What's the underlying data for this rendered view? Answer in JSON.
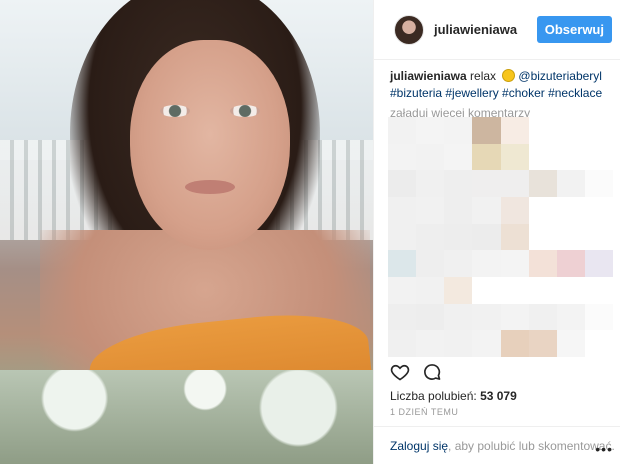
{
  "post": {
    "username": "juliawieniawa",
    "follow_label": "Obserwuj",
    "caption_user": "juliawieniawa",
    "caption_text": "relax",
    "caption_mention": "@bizuteriaberyl",
    "hashtags": "#bizuteria #jewellery #choker #necklace",
    "load_more": "załaduj więcej komentarzy",
    "likes_label": "Liczba polubień:",
    "likes_count": "53 079",
    "time_ago": "1 DZIEŃ TEMU",
    "login_link": "Zaloguj się",
    "login_rest": ", aby polubić lub skomentować.",
    "more_dots": "•••"
  },
  "colors": {
    "accent": "#3897f0",
    "link": "#003569",
    "muted": "#999999"
  },
  "icons": [
    "heart-icon",
    "comment-icon",
    "sun-emoji-icon",
    "more-options-icon"
  ],
  "blurred_pixels": [
    "#f2f2f2",
    "#f4f4f4",
    "#f3f3f3",
    "#cdb6a0",
    "#f7ece4",
    "#ffffff",
    "#ffffff",
    "#ffffff",
    "#f3f3f3",
    "#f2f2f2",
    "#f4f4f4",
    "#e6d8b6",
    "#efe8d2",
    "#ffffff",
    "#ffffff",
    "#ffffff",
    "#ececec",
    "#f0f0f0",
    "#eeeeee",
    "#efeeee",
    "#efeeee",
    "#e8e2da",
    "#f2f2f2",
    "#fbfbfb",
    "#f0f0f0",
    "#f1f1f1",
    "#eeeeee",
    "#f1f1f1",
    "#f0e6df",
    "#ffffff",
    "#ffffff",
    "#ffffff",
    "#f0f0f0",
    "#eeeeee",
    "#ededed",
    "#ececec",
    "#ede0d4",
    "#ffffff",
    "#ffffff",
    "#ffffff",
    "#dce7ea",
    "#eeeeee",
    "#f0f0f0",
    "#f3f3f3",
    "#f4f4f4",
    "#f3e1d8",
    "#eed0d3",
    "#e9e6f1",
    "#f2f2f2",
    "#f1f1f1",
    "#f3e9df",
    "#ffffff",
    "#ffffff",
    "#ffffff",
    "#ffffff",
    "#ffffff",
    "#eeeeee",
    "#ededed",
    "#f0f0f0",
    "#f1f1f1",
    "#f3f3f3",
    "#f0f0f0",
    "#f3f3f3",
    "#fbfbfb",
    "#f0f0f0",
    "#f2f2f2",
    "#f1f1f1",
    "#f3f3f3",
    "#e7d0bc",
    "#e9d4c3",
    "#f6f6f6",
    "#ffffff"
  ]
}
